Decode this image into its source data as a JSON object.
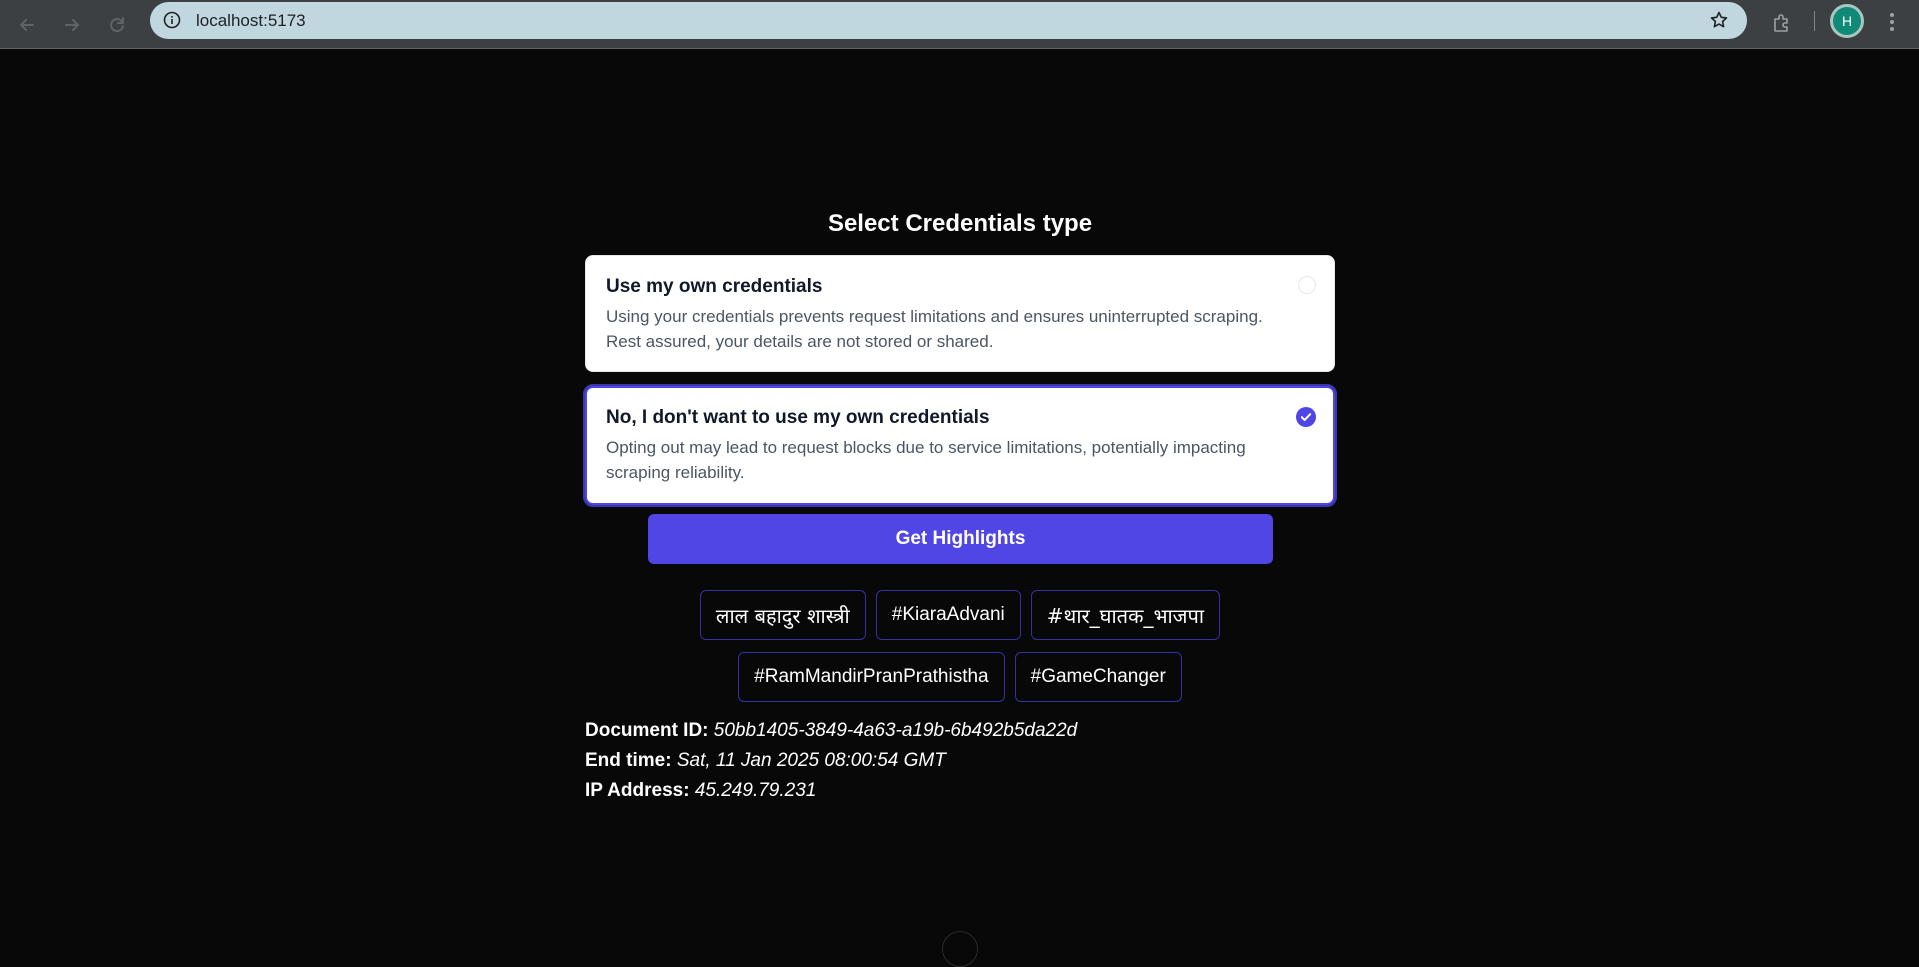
{
  "browser": {
    "url": "localhost:5173",
    "profile_initial": "H",
    "icons": {
      "back": "back-arrow-icon",
      "forward": "forward-arrow-icon",
      "reload": "reload-icon",
      "site_info": "info-icon",
      "bookmark": "star-icon",
      "extensions": "puzzle-icon",
      "menu": "kebab-menu-icon"
    }
  },
  "page": {
    "heading": "Select Credentials type",
    "options": [
      {
        "title": "Use my own credentials",
        "description": "Using your credentials prevents request limitations and ensures uninterrupted scraping. Rest assured, your details are not stored or shared.",
        "selected": false
      },
      {
        "title": "No, I don't want to use my own credentials",
        "description": "Opting out may lead to request blocks due to service limitations, potentially impacting scraping reliability.",
        "selected": true
      }
    ],
    "cta_label": "Get Highlights",
    "tags": [
      "लाल बहादुर शास्त्री",
      "#KiaraAdvani",
      "#थार_घातक_भाजपा",
      "#RamMandirPranPrathistha",
      "#GameChanger"
    ],
    "meta": {
      "document_id_label": "Document ID:",
      "document_id": "50bb1405-3849-4a63-a19b-6b492b5da22d",
      "end_time_label": "End time:",
      "end_time": "Sat, 11 Jan 2025 08:00:54 GMT",
      "ip_label": "IP Address:",
      "ip": "45.249.79.231"
    }
  },
  "colors": {
    "background": "#080808",
    "accent": "#4f46e5",
    "tag_border": "#3730a3",
    "card_bg": "#ffffff"
  }
}
